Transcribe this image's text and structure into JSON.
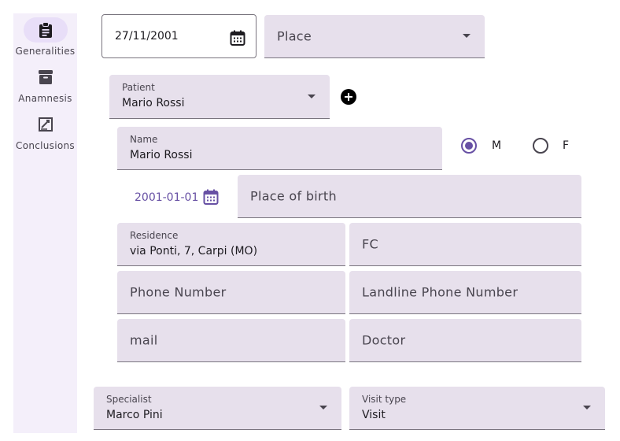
{
  "nav": {
    "items": [
      {
        "label": "Generalities",
        "icon": "clipboard-icon",
        "active": true
      },
      {
        "label": "Anamnesis",
        "icon": "archive-icon",
        "active": false
      },
      {
        "label": "Conclusions",
        "icon": "signature-icon",
        "active": false
      }
    ]
  },
  "visit": {
    "date": "27/11/2001",
    "place_placeholder": "Place"
  },
  "patient": {
    "select_label": "Patient",
    "select_value": "Mario Rossi",
    "name_label": "Name",
    "name_value": "Mario Rossi",
    "sex_options": [
      "M",
      "F"
    ],
    "sex_selected": "M",
    "birth_date": "2001-01-01",
    "place_of_birth_placeholder": "Place of birth",
    "residence_label": "Residence",
    "residence_value": "via Ponti, 7, Carpi (MO)",
    "fc_placeholder": "FC",
    "phone_placeholder": "Phone Number",
    "landline_placeholder": "Landline Phone Number",
    "mail_placeholder": "mail",
    "doctor_placeholder": "Doctor"
  },
  "specialist": {
    "label": "Specialist",
    "value": "Marco Pini"
  },
  "visit_type": {
    "label": "Visit type",
    "value": "Visit"
  },
  "colors": {
    "accent": "#6750a4",
    "field_bg": "#e7e0ec",
    "rail_bg": "#f4effa",
    "active_indicator": "#e8def8"
  }
}
